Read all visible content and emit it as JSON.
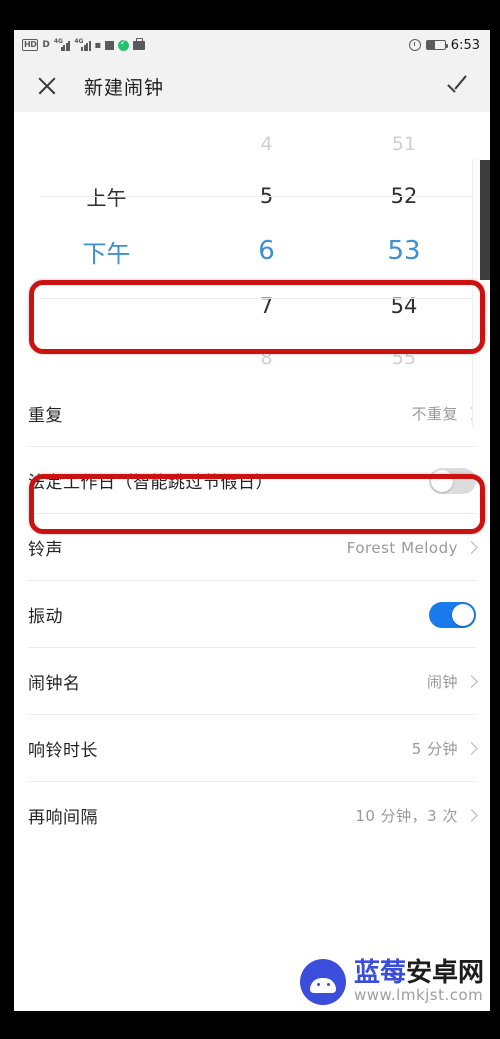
{
  "status_bar": {
    "hd_label": "HD",
    "d_label": "D",
    "network_label": "4G",
    "icons": [
      "hd-icon",
      "data-icon",
      "signal-4g-icon",
      "signal-4g-icon-2",
      "wifi-icon",
      "sdcard-icon",
      "green-check-icon",
      "briefcase-icon",
      "alarm-icon",
      "battery-icon"
    ],
    "time": "6:53"
  },
  "app_bar": {
    "close_icon": "close-icon",
    "title": "新建闹钟",
    "confirm_icon": "check-icon"
  },
  "time_picker": {
    "ampm": {
      "above": "上午",
      "selected": "下午"
    },
    "hours": {
      "far_above": "4",
      "above": "5",
      "selected": "6",
      "below": "7",
      "far_below": "8"
    },
    "minutes": {
      "far_above": "51",
      "above": "52",
      "selected": "53",
      "below": "54",
      "far_below": "55"
    },
    "selected_color": "#3d8fd1"
  },
  "settings": {
    "rows": [
      {
        "label": "重复",
        "value": "不重复",
        "control": "chevron",
        "highlighted": true
      },
      {
        "label": "法定工作日（智能跳过节假日）",
        "value": "",
        "control": "toggle",
        "toggle_on": false
      },
      {
        "label": "铃声",
        "value": "Forest Melody",
        "control": "chevron"
      },
      {
        "label": "振动",
        "value": "",
        "control": "toggle",
        "toggle_on": true
      },
      {
        "label": "闹钟名",
        "value": "闹钟",
        "control": "chevron"
      },
      {
        "label": "响铃时长",
        "value": "5 分钟",
        "control": "chevron"
      },
      {
        "label": "再响间隔",
        "value": "10 分钟，3 次",
        "control": "chevron"
      }
    ]
  },
  "annotations": {
    "color": "#cc1111",
    "boxes": [
      "selected-time-row",
      "repeat-row"
    ]
  },
  "watermark": {
    "title_blue": "蓝莓",
    "title_dark": "安卓网",
    "url": "www.lmkjst.com",
    "logo_color": "#3b4ddb"
  }
}
